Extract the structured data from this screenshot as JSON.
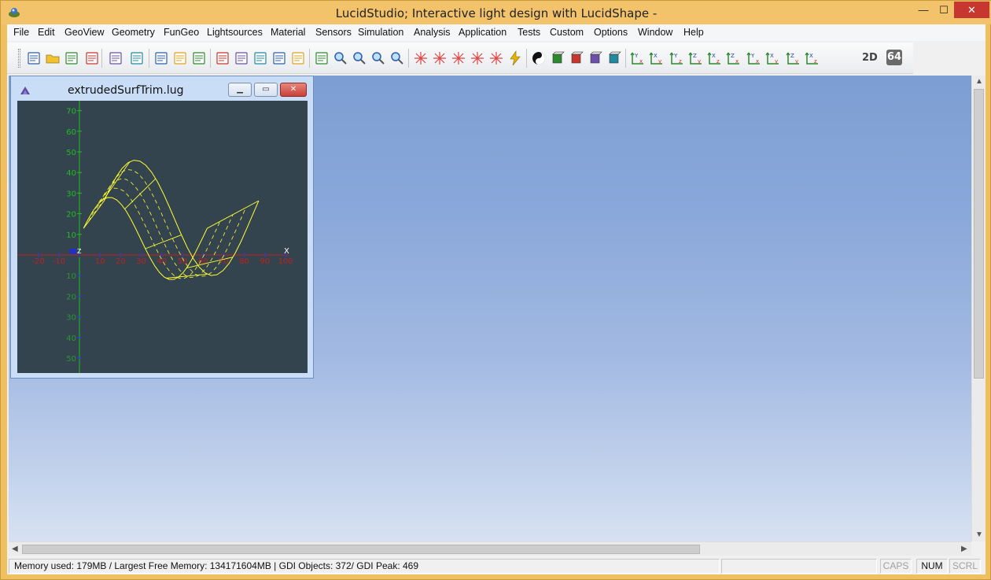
{
  "window": {
    "title": "LucidStudio; Interactive light design with LucidShape -",
    "min_glyph": "—",
    "max_glyph": "☐",
    "close_glyph": "✕",
    "icon": "lucid-app-icon"
  },
  "menu": [
    "File",
    "Edit",
    "GeoView",
    "Geometry",
    "FunGeo",
    "Lightsources",
    "Material",
    "Sensors",
    "Simulation",
    "Analysis",
    "Application",
    "Tests",
    "Custom",
    "Options",
    "Window",
    "Help"
  ],
  "toolbar": {
    "icons": [
      "new-document-icon",
      "open-folder-icon",
      "add-geometry-icon",
      "import-icon",
      "open-file-icon",
      "print-icon",
      "cascade-windows-icon",
      "tile-vertical-icon",
      "tile-horizontal-icon",
      "geometry-view-icon",
      "shape-view-icon",
      "plot-view-icon",
      "false-color-view-icon",
      "table-view-icon",
      "report-icon",
      "zoom-fit-icon",
      "zoom-all-icon",
      "zoom-in-icon",
      "zoom-out-icon",
      "mesh-icon",
      "mesh-m-icon",
      "mesh-r-icon",
      "delete-mesh-icon",
      "delete-x-icon",
      "lightning-icon",
      "yin-yang-icon",
      "solid-cube-icon",
      "wire-cube-icon",
      "color-cube-icon",
      "cube-shuffle-icon",
      "axis-yx-icon",
      "axis-xy-icon",
      "axis-yz-icon",
      "axis-zy-icon",
      "axis-xz-icon",
      "axis-zx-icon",
      "axis-yx2-icon",
      "axis-xyz-icon",
      "axis-zyx-icon",
      "axis-xzz-icon"
    ],
    "label_2d": "2D",
    "label_64": "64"
  },
  "child_window": {
    "title": "extrudedSurfTrim.lug",
    "icon": "lucid-doc-icon",
    "min_glyph": "▁",
    "max_glyph": "▭",
    "close_glyph": "✕"
  },
  "chart_data": {
    "type": "line",
    "title": "",
    "x_axis_label": "X",
    "y_axis_label": "",
    "x_ticks": [
      "-20",
      "-10",
      "0",
      "10",
      "20",
      "30",
      "40",
      "50",
      "60",
      "70",
      "80",
      "90",
      "100"
    ],
    "y_ticks_pos": [
      "10",
      "20",
      "30",
      "40",
      "50",
      "60",
      "70"
    ],
    "y_ticks_neg": [
      "10",
      "20",
      "30",
      "40",
      "50"
    ],
    "origin_label": "Z",
    "surface_color": "#ffff33",
    "background": "#34444f",
    "x_axis_color": "#c02020",
    "y_axis_color": "#22bb22"
  },
  "status": {
    "memory": "Memory used:    179MB / Largest Free Memory:   134171604MB  | GDI Objects: 372/ GDI Peak: 469",
    "caps": "CAPS",
    "num": "NUM",
    "scrl": "SCRL"
  }
}
